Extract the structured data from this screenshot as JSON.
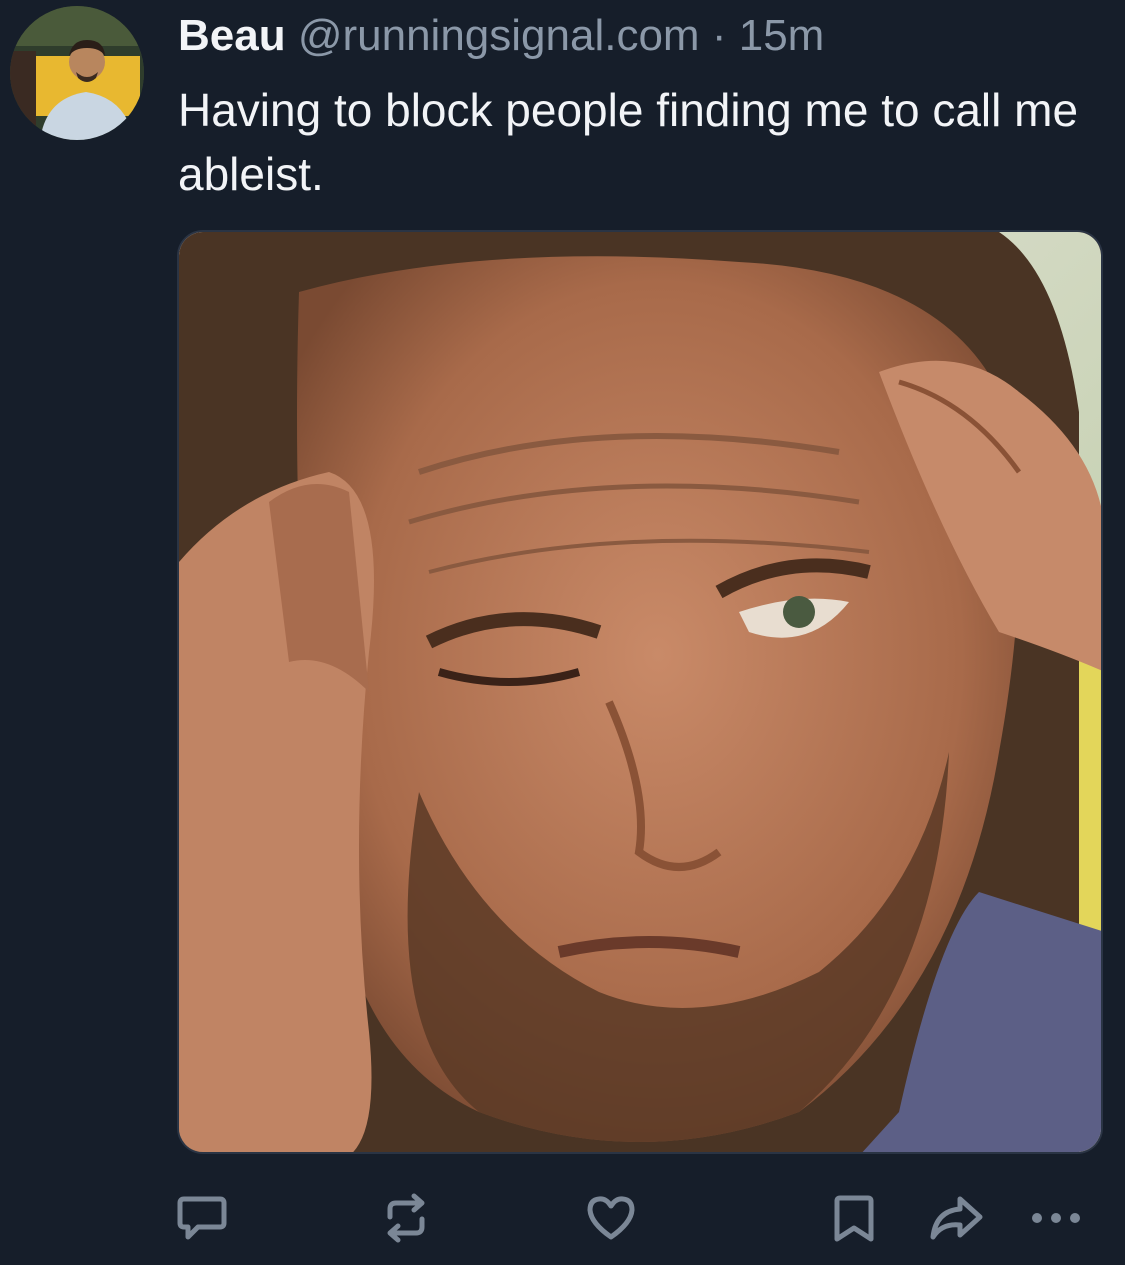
{
  "post": {
    "author_name": "Beau",
    "author_handle": "@runningsignal.com",
    "separator": "·",
    "timestamp": "15m",
    "text": "Having to block people finding me to call me ableist."
  },
  "avatar": {
    "icon": "user-avatar"
  },
  "media": {
    "icon": "photo-man-rubbing-temples"
  },
  "actions": [
    {
      "icon": "reply-icon"
    },
    {
      "icon": "repost-icon"
    },
    {
      "icon": "like-icon"
    },
    {
      "icon": "bookmark-icon"
    },
    {
      "icon": "share-icon"
    },
    {
      "icon": "more-options-icon"
    }
  ],
  "colors": {
    "background": "#161e2a",
    "text_primary": "#f2f4f7",
    "text_secondary": "#8b98a8",
    "icon": "#7b8796"
  }
}
